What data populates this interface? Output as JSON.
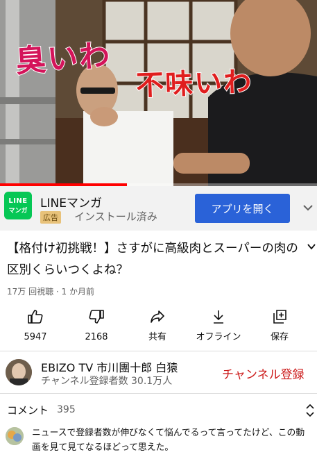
{
  "video": {
    "caption_left": "臭いわ",
    "caption_right": "不味いわ",
    "progress": 0.4
  },
  "ad": {
    "logo_line1": "LINE",
    "logo_line2": "マンガ",
    "title": "LINEマンガ",
    "badge": "広告",
    "subtitle": "インストール済み",
    "button_label": "アプリを開く"
  },
  "video_info": {
    "title": "【格付け初挑戦！】さすがに高級肉とスーパーの肉の区別くらいつくよね？",
    "meta": "17万 回視聴 · 1 か月前"
  },
  "actions": [
    {
      "label": "5947",
      "icon": "thumbs-up-icon"
    },
    {
      "label": "2168",
      "icon": "thumbs-down-icon"
    },
    {
      "label": "共有",
      "icon": "share-icon"
    },
    {
      "label": "オフライン",
      "icon": "download-icon"
    },
    {
      "label": "保存",
      "icon": "save-to-playlist-icon"
    }
  ],
  "channel": {
    "name": "EBIZO TV 市川團十郎 白猿",
    "subscribers": "チャンネル登録者数 30.1万人",
    "subscribe_label": "チャンネル登録"
  },
  "comments": {
    "label": "コメント",
    "count": "395",
    "top_comment": "ニュースで登録者数が伸びなくて悩んでるって言ってたけど、この動画を見て見てなるほどって思えた。"
  },
  "colors": {
    "accent_red": "#ff0000",
    "subscribe_red": "#cc1a1a",
    "ad_button_blue": "#2a62d8",
    "line_green": "#06c755"
  }
}
